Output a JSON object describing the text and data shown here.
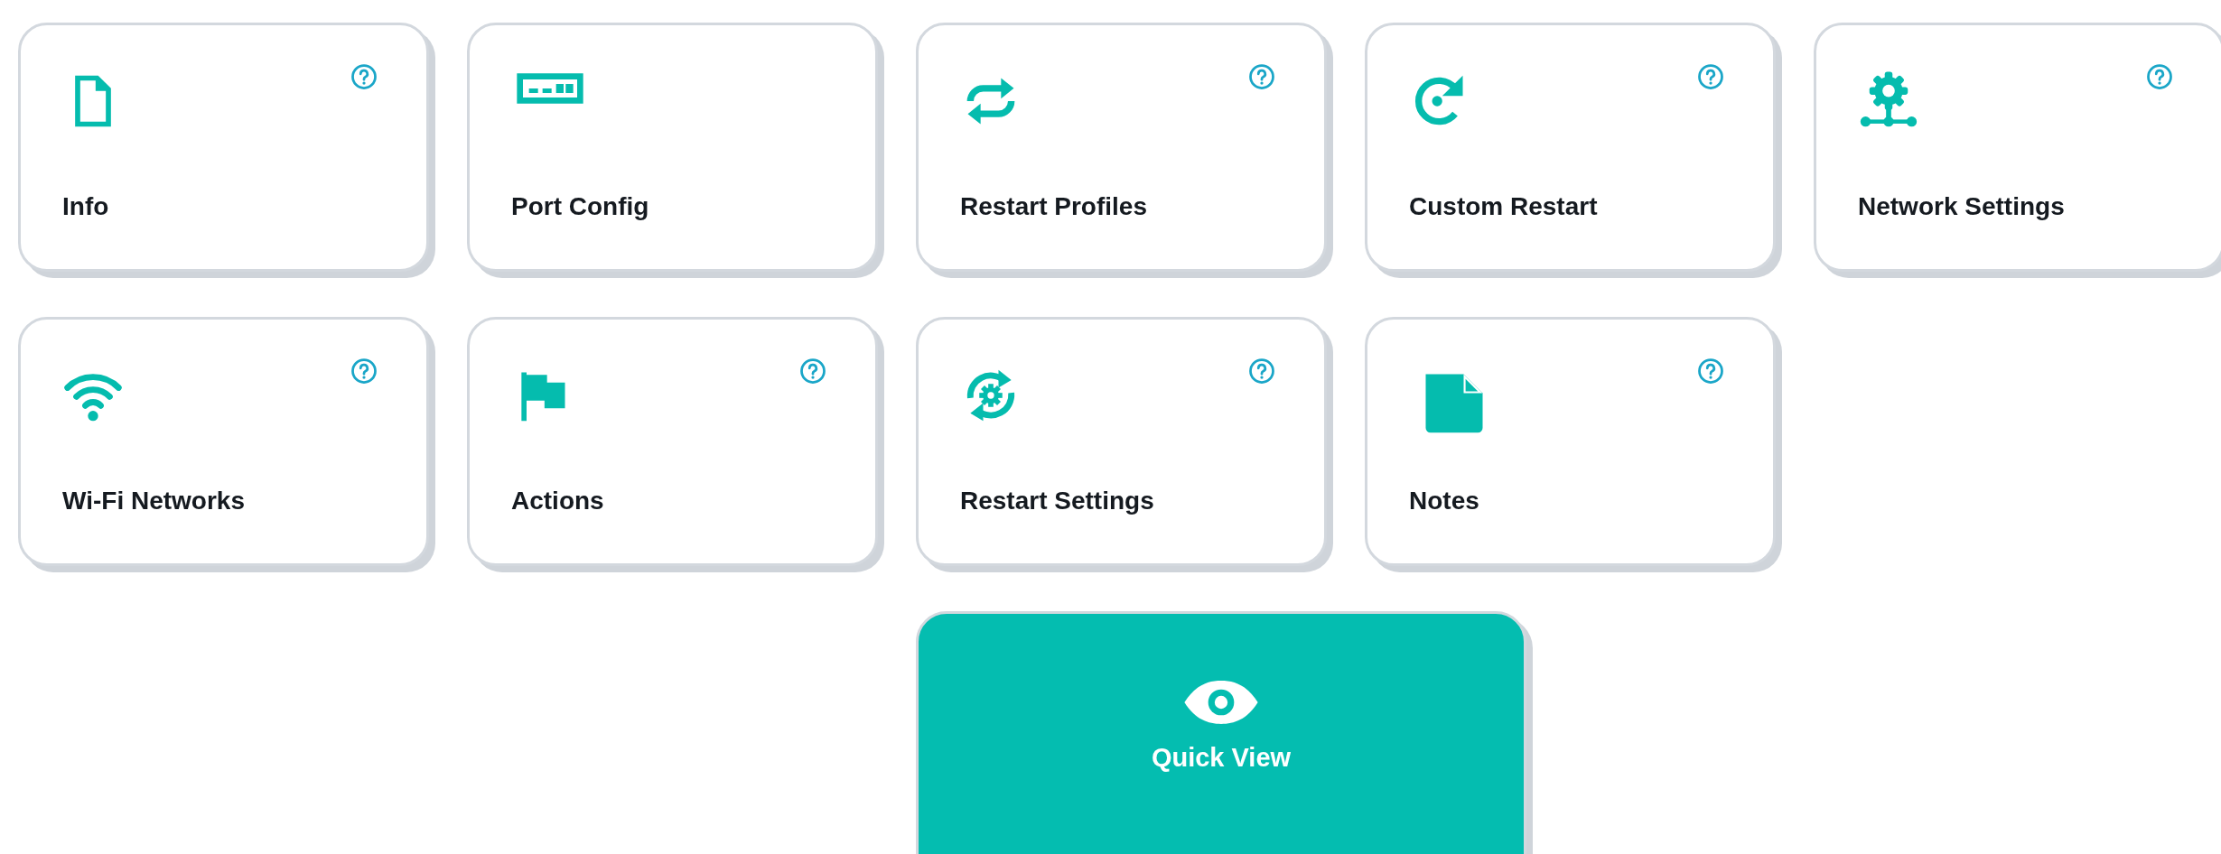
{
  "tiles": [
    {
      "label": "Info",
      "help": true
    },
    {
      "label": "Port Config",
      "help": false
    },
    {
      "label": "Restart Profiles",
      "help": true
    },
    {
      "label": "Custom Restart",
      "help": true
    },
    {
      "label": "Network Settings",
      "help": true
    },
    {
      "label": "Wi-Fi Networks",
      "help": true
    },
    {
      "label": "Actions",
      "help": true
    },
    {
      "label": "Restart Settings",
      "help": true
    },
    {
      "label": "Notes",
      "help": true
    }
  ],
  "quick_view": {
    "label": "Quick View"
  }
}
